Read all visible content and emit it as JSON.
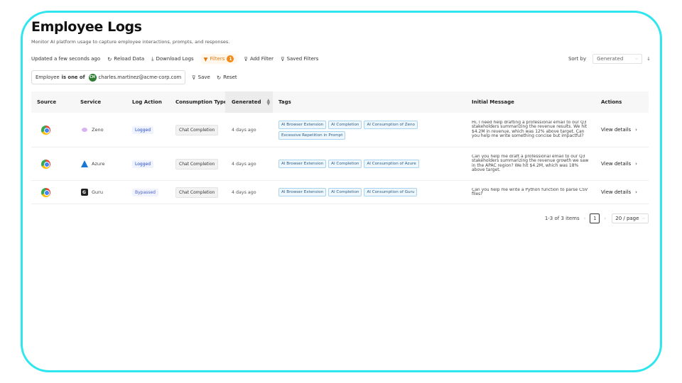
{
  "page": {
    "title": "Employee Logs",
    "subtitle": "Monitor AI platform usage to capture employee interactions, prompts, and responses."
  },
  "toolbar": {
    "updated": "Updated a few seconds ago",
    "reload": "Reload Data",
    "download": "Download Logs",
    "filters": "Filters",
    "filters_count": "1",
    "add_filter": "Add Filter",
    "saved_filters": "Saved Filters",
    "sort_label": "Sort by",
    "sort_value": "Generated"
  },
  "filter": {
    "field": "Employee",
    "operator": "is one of",
    "avatar_initials": "CH",
    "value": "charles.martinez@acme-corp.com",
    "save": "Save",
    "reset": "Reset"
  },
  "table": {
    "columns": [
      "Source",
      "Service",
      "Log Action",
      "Consumption Type",
      "Generated",
      "Tags",
      "Initial Message",
      "Actions"
    ],
    "rows": [
      {
        "source_icon": "chrome-icon",
        "service": "Zeno",
        "log_action": "Logged",
        "consumption": "Chat Completion",
        "generated": "4 days ago",
        "tags": [
          "AI Browser Extension",
          "AI Completion",
          "AI Consumption of Zeno",
          "Excessive Repetition in Prompt"
        ],
        "message": "Hi, I need help drafting a professional email to our Q3 stakeholders summarizing the revenue results. We hit $4.2M in revenue, which was 12% above target. Can you help me write something concise but impactful?",
        "action": "View details"
      },
      {
        "source_icon": "chrome-icon",
        "service": "Azure",
        "log_action": "Logged",
        "consumption": "Chat Completion",
        "generated": "4 days ago",
        "tags": [
          "AI Browser Extension",
          "AI Completion",
          "AI Consumption of Azure"
        ],
        "message": "Can you help me draft a professional email to our Q3 stakeholders summarizing the revenue growth we saw in the APAC region? We hit $4.2M, which was 18% above target.",
        "action": "View details"
      },
      {
        "source_icon": "chrome-icon",
        "service": "Guru",
        "log_action": "Bypassed",
        "consumption": "Chat Completion",
        "generated": "4 days ago",
        "tags": [
          "AI Browser Extension",
          "AI Completion",
          "AI Consumption of Guru"
        ],
        "message": "Can you help me write a Python function to parse CSV files?",
        "action": "View details"
      }
    ]
  },
  "pagination": {
    "summary": "1-3 of 3 items",
    "current_page": "1",
    "page_size": "20 / page"
  }
}
